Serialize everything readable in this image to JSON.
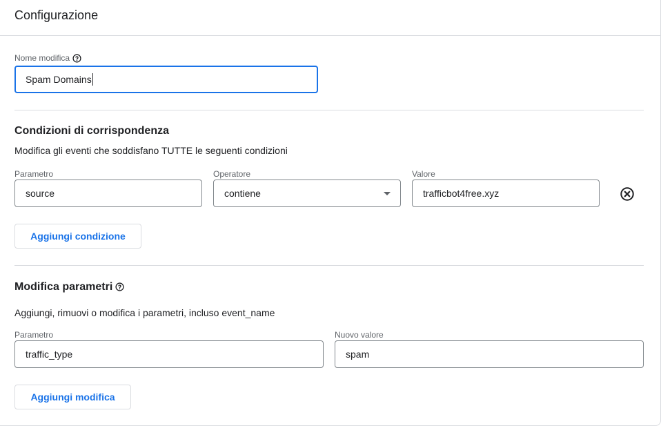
{
  "header": {
    "title": "Configurazione"
  },
  "name_field": {
    "label": "Nome modifica",
    "value": "Spam Domains"
  },
  "match_conditions": {
    "title": "Condizioni di corrispondenza",
    "description": "Modifica gli eventi che soddisfano TUTTE le seguenti condizioni",
    "param_label": "Parametro",
    "operator_label": "Operatore",
    "value_label": "Valore",
    "param_value": "source",
    "operator_value": "contiene",
    "value_value": "trafficbot4free.xyz",
    "add_button": "Aggiungi condizione"
  },
  "modify_params": {
    "title": "Modifica parametri",
    "description": "Aggiungi, rimuovi o modifica i parametri, incluso event_name",
    "param_label": "Parametro",
    "new_value_label": "Nuovo valore",
    "param_value": "traffic_type",
    "new_value": "spam",
    "add_button": "Aggiungi modifica"
  },
  "icons": {
    "help": "help-icon",
    "remove": "close-circle-icon",
    "dropdown": "chevron-down-icon"
  },
  "colors": {
    "accent": "#1a73e8",
    "border": "#80868b",
    "divider": "#dadce0"
  }
}
